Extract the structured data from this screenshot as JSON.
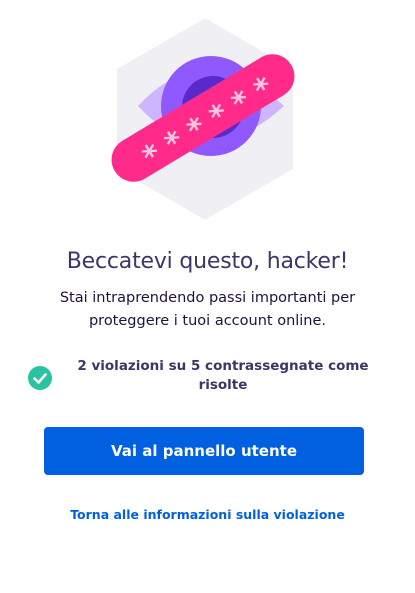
{
  "hero": {
    "icon": "eye-password-bandage-icon",
    "colors": {
      "hexagon": "#f0f0f4",
      "eye_outer": "#cdb6ff",
      "eye_iris": "#9059ff",
      "eye_pupil": "#592acb",
      "bandage": "#ff2a8a",
      "asterisks": "#ffc4e0"
    }
  },
  "title": "Beccatevi questo, hacker!",
  "description": "Stai intraprendendo passi importanti per proteggere i tuoi account online.",
  "status": {
    "icon": "check-circle-icon",
    "text": "2 violazioni su 5 contrassegnate come risolte",
    "color": "#2ac3a2"
  },
  "cta_button": {
    "label": "Vai al pannello utente",
    "color": "#0060df"
  },
  "back_link": {
    "label": "Torna alle informazioni sulla violazione"
  }
}
